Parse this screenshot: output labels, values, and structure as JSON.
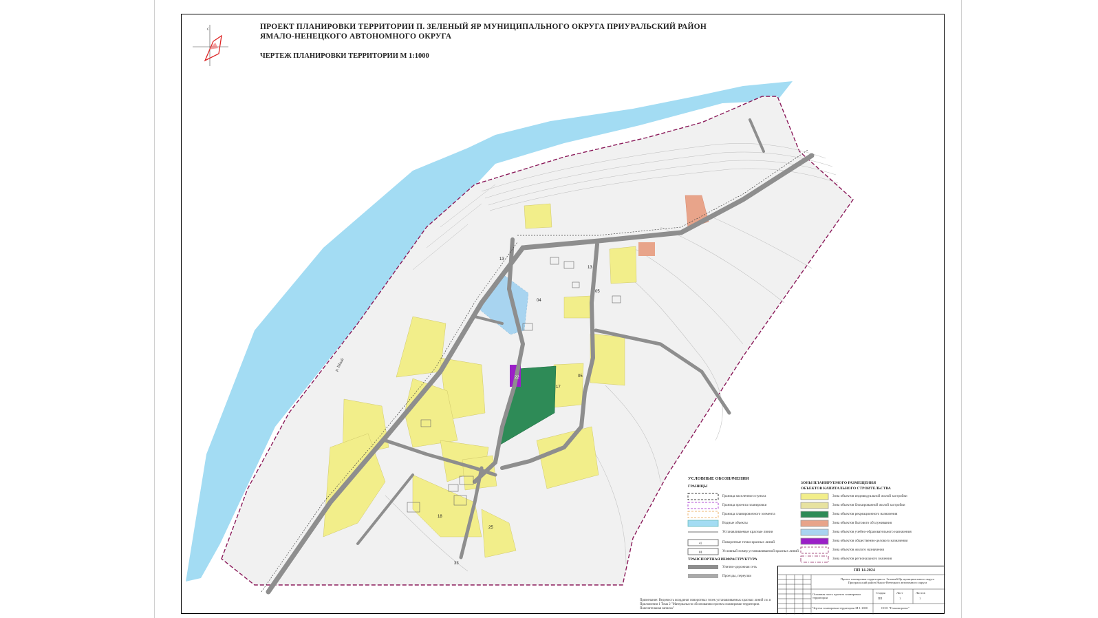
{
  "title_lines": [
    "ПРОЕКТ ПЛАНИРОВКИ ТЕРРИТОРИИ П. ЗЕЛЕНЫЙ ЯР МУНИЦИПАЛЬНОГО ОКРУГА ПРИУРАЛЬСКИЙ РАЙОН",
    "ЯМАЛО-НЕНЕЦКОГО АВТОНОМНОГО ОКРУГА"
  ],
  "subtitle": "ЧЕРТЕЖ ПЛАНИРОВКИ ТЕРРИТОРИИ М 1:1000",
  "river_label": "р. Шаай",
  "legend": {
    "heading": "УСЛОВНЫЕ ОБОЗНАЧЕНИЯ",
    "borders_heading": "ГРАНИЦЫ",
    "borders": [
      {
        "label": "Граница населенного пункта",
        "swatch": "dash-black"
      },
      {
        "label": "Граница проекта планировки",
        "swatch": "dash-magenta"
      },
      {
        "label": "Граница планировочного элемента",
        "swatch": "dash-orange"
      },
      {
        "label": "Водные объекты",
        "swatch": "water"
      },
      {
        "label": "Устанавливаемые красные линии",
        "swatch": "redline"
      },
      {
        "label": "Поворотные точки красных линий",
        "swatch": "point",
        "mark": "•1"
      },
      {
        "label": "Условный номер устанавливаемой красных линий",
        "swatch": "number",
        "mark": "01"
      }
    ],
    "transport_heading": "ТРАНСПОРТНАЯ ИНФРАСТРУКТУРА",
    "transport": [
      {
        "label": "Улично-дорожная сеть",
        "swatch": "road"
      },
      {
        "label": "Проезды, переулки",
        "swatch": "lane"
      }
    ],
    "zones_heading_1": "ЗОНЫ ПЛАНИРУЕМОГО РАЗМЕЩЕНИЯ",
    "zones_heading_2": "ОБЪЕКТОВ КАПИТАЛЬНОГО СТРОИТЕЛЬСТВА",
    "zones": [
      {
        "label": "Зона объектов индивидуальной жилой застройки",
        "color": "#f2ee8a"
      },
      {
        "label": "Зона объектов блокированной жилой застройки",
        "color": "#e7e2a0"
      },
      {
        "label": "Зона объектов рекреационного назначения",
        "color": "#2e8b57"
      },
      {
        "label": "Зона объектов бытового обслуживания",
        "color": "#e8a48a"
      },
      {
        "label": "Зона объектов учебно-образовательного назначения",
        "color": "#a8d4f0"
      },
      {
        "label": "Зона объектов общественно-делового назначения",
        "color": "#9b1fc7"
      },
      {
        "label": "Зона объектов жилого назначения",
        "color": "dash"
      },
      {
        "label": "Зона объектов регионального значения",
        "color": "dashdot"
      }
    ]
  },
  "note": "Примечание: Ведомость координат поворотных точек устанавливаемых красных линий см. в Приложении 1 Тома 2 \"Материалы по обоснованию проекта планировки территории. Пояснительная записка\"",
  "stamp": {
    "code": "ПП 14-2024",
    "project": "Проект планировки территории п. Зеленый Яр муниципального округа Приуральский район Ямало-Ненецкого автономного округа",
    "part": "Основная часть проекта планировки территории",
    "stage": "ПП",
    "sheet": "1",
    "sheets": "1",
    "drawing": "Чертеж планировки территории М 1:1000",
    "org": "ООО \"Геокомпроект\"",
    "stage_h": "Стадия",
    "sheet_h": "Лист",
    "sheets_h": "Листов"
  },
  "colors": {
    "water": "#a3dcf3",
    "road": "#8e8e8e",
    "individual": "#f2ee8a",
    "recreation": "#2e8b57",
    "education": "#a8d4f0",
    "public": "#9b1fc7",
    "service": "#e8a48a",
    "border": "#8b1a5a"
  },
  "block_labels": [
    "04",
    "05",
    "13",
    "13",
    "05",
    "22",
    "25",
    "33",
    "17",
    "18"
  ]
}
